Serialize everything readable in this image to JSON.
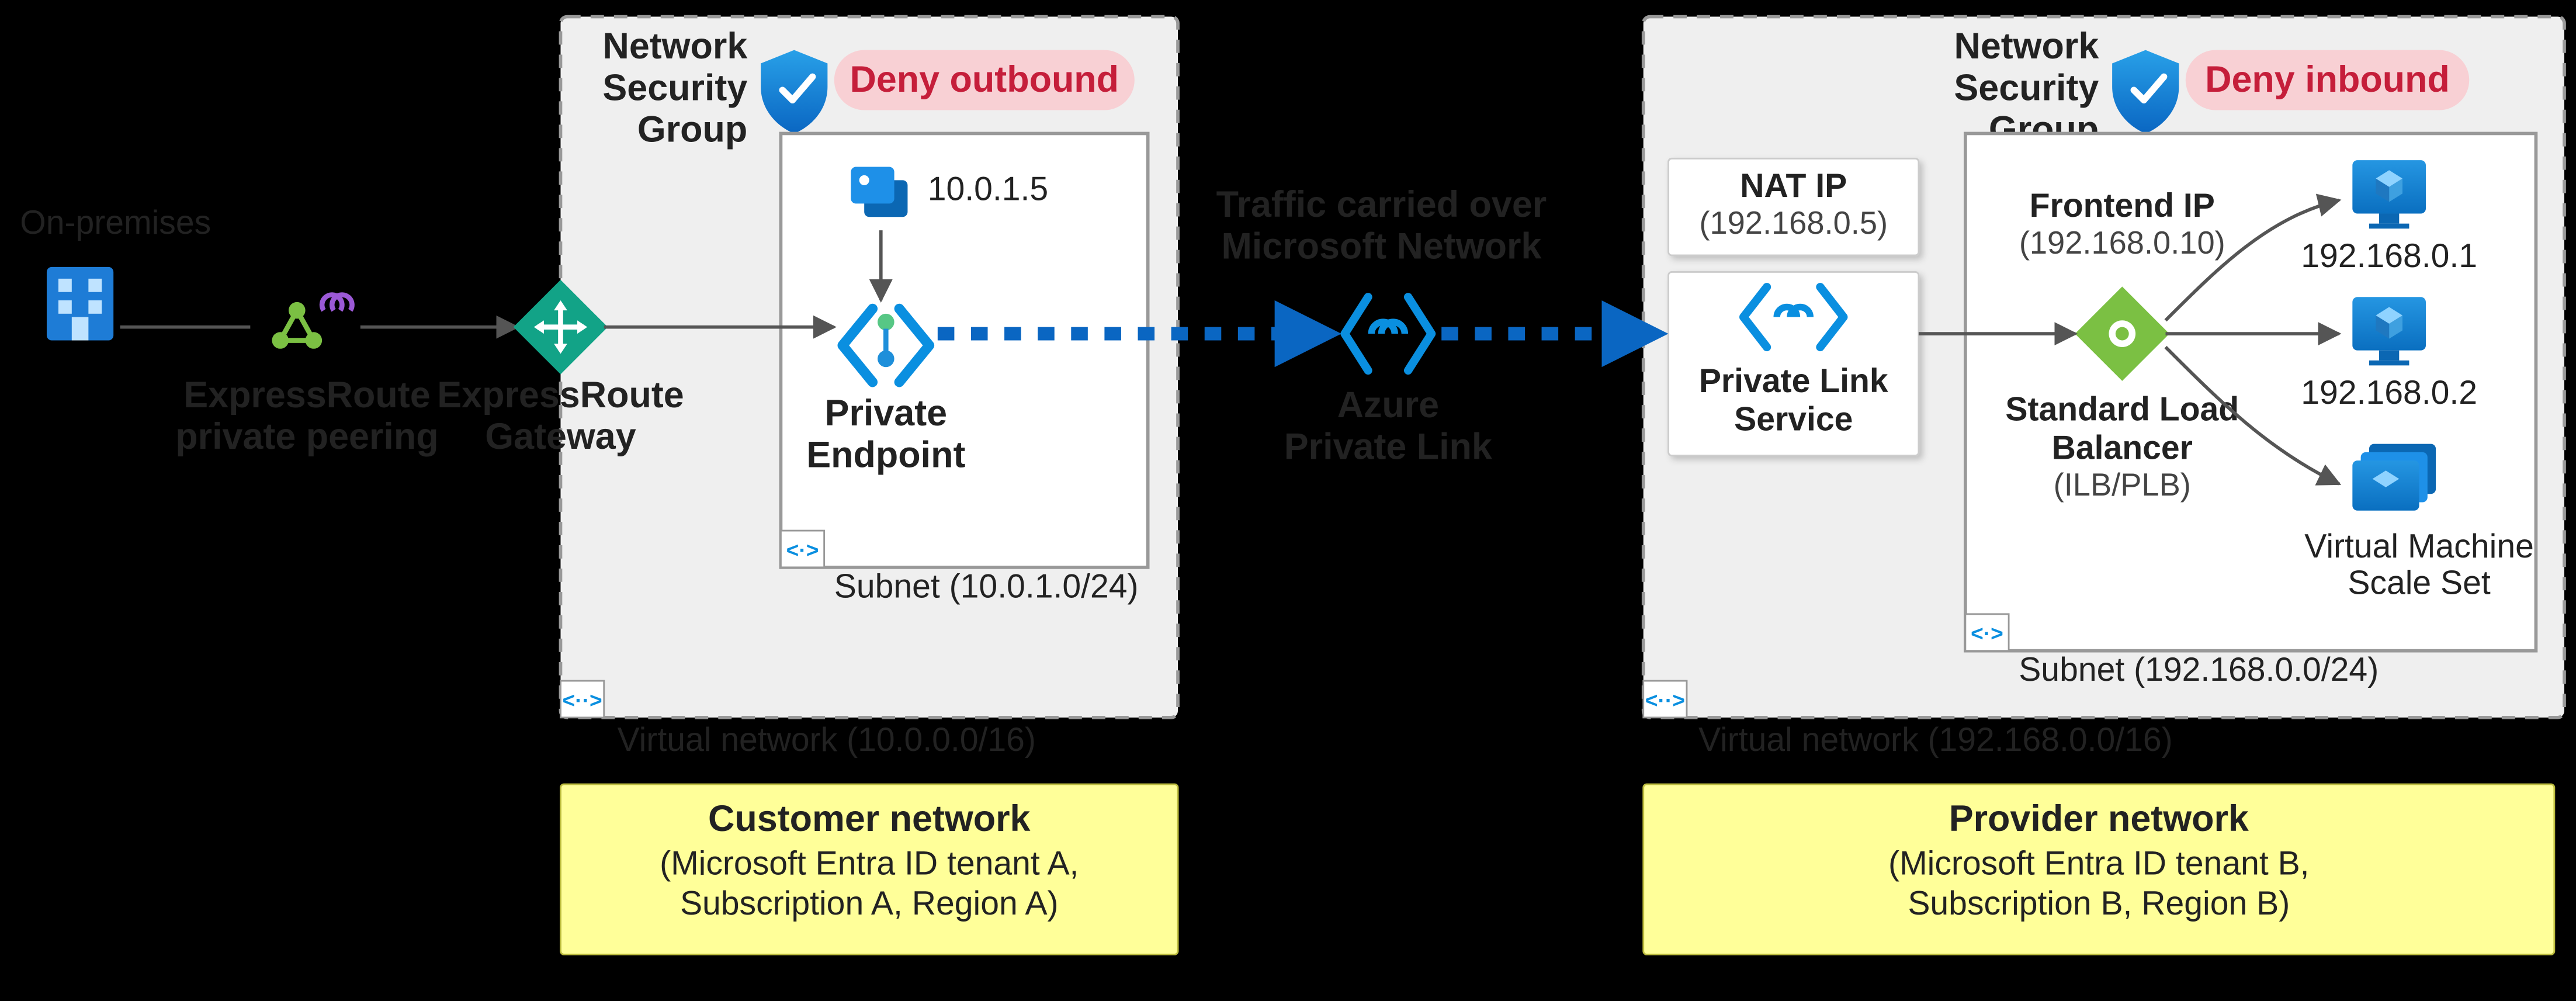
{
  "onprem": {
    "label": "On-premises"
  },
  "expressroute_peering": {
    "label1": "ExpressRoute",
    "label2": "private peering"
  },
  "expressroute_gateway": {
    "label1": "ExpressRoute",
    "label2": "Gateway"
  },
  "customer_vnet": {
    "nsg_label1": "Network",
    "nsg_label2": "Security",
    "nsg_label3": "Group",
    "deny_label": "Deny outbound",
    "nic_ip": "10.0.1.5",
    "pe_label1": "Private",
    "pe_label2": "Endpoint",
    "subnet_label": "Subnet (10.0.1.0/24)",
    "vnet_label": "Virtual network (10.0.0.0/16)"
  },
  "traffic": {
    "line1": "Traffic carried over",
    "line2": "Microsoft Network"
  },
  "private_link": {
    "label1": "Azure",
    "label2": "Private Link"
  },
  "provider_vnet": {
    "nsg_label1": "Network",
    "nsg_label2": "Security",
    "nsg_label3": "Group",
    "deny_label": "Deny inbound",
    "nat_label": "NAT IP",
    "nat_ip": "(192.168.0.5)",
    "pls_label1": "Private Link",
    "pls_label2": "Service",
    "frontend_label": "Frontend IP",
    "frontend_ip": "(192.168.0.10)",
    "lb_label1": "Standard Load",
    "lb_label2": "Balancer",
    "lb_sub": "(ILB/PLB)",
    "vm1_ip": "192.168.0.1",
    "vm2_ip": "192.168.0.2",
    "vmss_label1": "Virtual Machine",
    "vmss_label2": "Scale Set",
    "subnet_label": "Subnet (192.168.0.0/24)",
    "vnet_label": "Virtual network (192.168.0.0/16)"
  },
  "customer_box": {
    "title": "Customer network",
    "line1": "(Microsoft Entra ID tenant A,",
    "line2": "Subscription A, Region A)"
  },
  "provider_box": {
    "title": "Provider network",
    "line1": "(Microsoft Entra ID tenant B,",
    "line2": "Subscription B, Region B)"
  }
}
